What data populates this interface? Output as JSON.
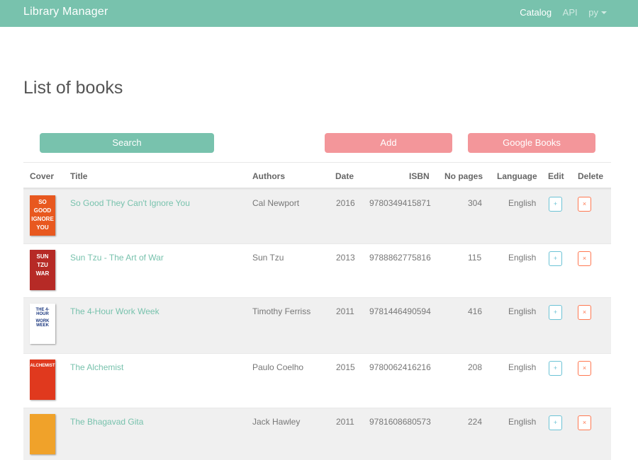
{
  "navbar": {
    "brand": "Library Manager",
    "links": [
      "Catalog",
      "API",
      "py"
    ]
  },
  "page": {
    "title": "List of books"
  },
  "actions": {
    "search": "Search",
    "add": "Add",
    "google": "Google Books"
  },
  "table": {
    "headers": [
      "Cover",
      "Title",
      "Authors",
      "Date",
      "ISBN",
      "No pages",
      "Language",
      "Edit",
      "Delete"
    ],
    "rows": [
      {
        "title": "So Good They Can't Ignore You",
        "author": "Cal Newport",
        "date": "2016",
        "isbn": "9780349415871",
        "pages": "304",
        "language": "English",
        "cover": {
          "bg": "#e8581f",
          "lines": [
            "SO",
            "GOOD",
            "IGNORE",
            "YOU"
          ]
        }
      },
      {
        "title": "Sun Tzu - The Art of War",
        "author": "Sun Tzu",
        "date": "2013",
        "isbn": "9788862775816",
        "pages": "115",
        "language": "English",
        "cover": {
          "bg": "#b62a26",
          "lines": [
            "SUN",
            "TZU",
            "WAR"
          ]
        }
      },
      {
        "title": "The 4-Hour Work Week",
        "author": "Timothy Ferriss",
        "date": "2011",
        "isbn": "9781446490594",
        "pages": "416",
        "language": "English",
        "cover": {
          "bg": "#ffffff",
          "lines": [
            "THE 4-HOUR",
            "WORK WEEK"
          ]
        }
      },
      {
        "title": "The Alchemist",
        "author": "Paulo Coelho",
        "date": "2015",
        "isbn": "9780062416216",
        "pages": "208",
        "language": "English",
        "cover": {
          "bg": "#e0391e",
          "lines": [
            "ALCHEMIST"
          ]
        }
      },
      {
        "title": "The Bhagavad Gita",
        "author": "Jack Hawley",
        "date": "2011",
        "isbn": "9781608680573",
        "pages": "224",
        "language": "English",
        "cover": {
          "bg": "#f0a22a",
          "lines": []
        }
      }
    ],
    "edit_symbol": "+",
    "delete_symbol": "×"
  },
  "colors": {
    "primary": "#78c2ad",
    "secondary": "#f3969a",
    "info": "#6cc3d5",
    "danger": "#ff7851"
  },
  "icons": {
    "edit": "plus-icon",
    "delete": "close-icon",
    "language_dropdown": "chevron-down-icon"
  }
}
